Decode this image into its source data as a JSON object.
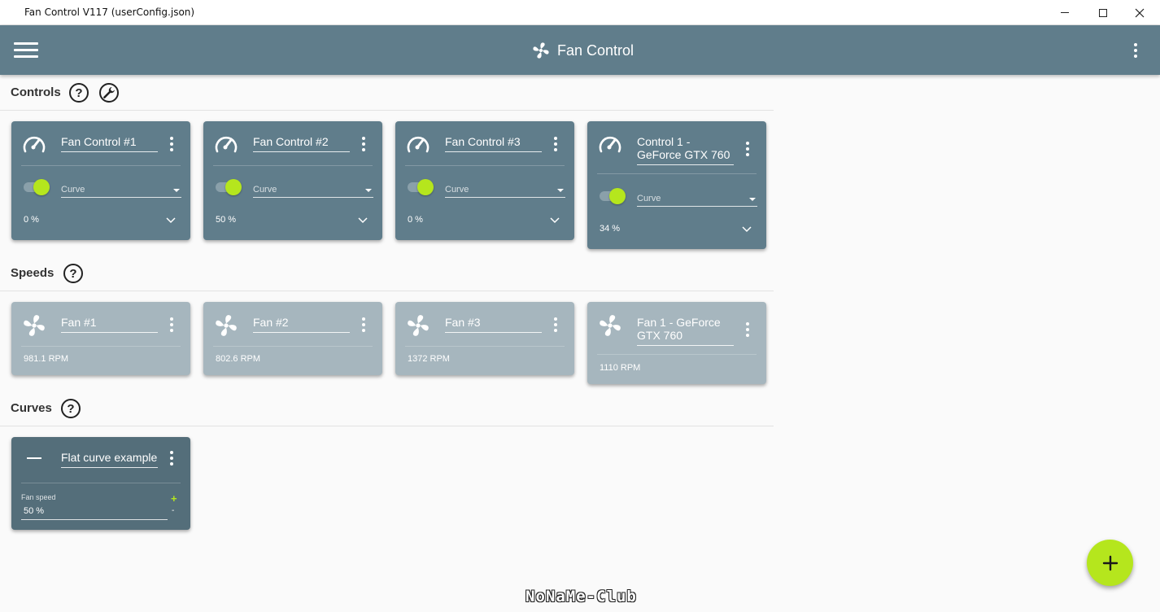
{
  "window": {
    "title": "Fan Control V117 (userConfig.json)",
    "controls": [
      "minimize-icon",
      "maximize-icon",
      "close-icon"
    ]
  },
  "appbar": {
    "title": "Fan Control",
    "menu_icon": "hamburger-menu-icon",
    "logo_icon": "fan-icon",
    "more_icon": "more-vert-icon",
    "color": "#607d8b"
  },
  "sections": {
    "controls": "Controls",
    "speeds": "Speeds",
    "curves": "Curves"
  },
  "controls": [
    {
      "name": "Fan Control #1",
      "curve": "Curve",
      "value": "0 %",
      "enabled": true
    },
    {
      "name": "Fan Control #2",
      "curve": "Curve",
      "value": "50 %",
      "enabled": true
    },
    {
      "name": "Fan Control #3",
      "curve": "Curve",
      "value": "0 %",
      "enabled": true
    },
    {
      "name": "Control 1 - GeForce GTX 760",
      "curve": "Curve",
      "value": "34 %",
      "enabled": true
    }
  ],
  "speeds": [
    {
      "name": "Fan #1",
      "rpm": "981.1 RPM"
    },
    {
      "name": "Fan #2",
      "rpm": "802.6 RPM"
    },
    {
      "name": "Fan #3",
      "rpm": "1372 RPM"
    },
    {
      "name": "Fan 1 - GeForce GTX 760",
      "rpm": "1110 RPM"
    }
  ],
  "curves": [
    {
      "name": "Flat curve example",
      "field_label": "Fan speed",
      "field_value": "50 %",
      "plus": "+",
      "minus": "-"
    }
  ],
  "fab": {
    "icon": "add-icon",
    "color": "#b5e61d"
  },
  "watermark": "NoNaMe-Club",
  "colors": {
    "accent": "#b5e61d",
    "control_card": "#607d8b",
    "speed_card": "#a6b6be",
    "curve_card": "#546e7a"
  }
}
